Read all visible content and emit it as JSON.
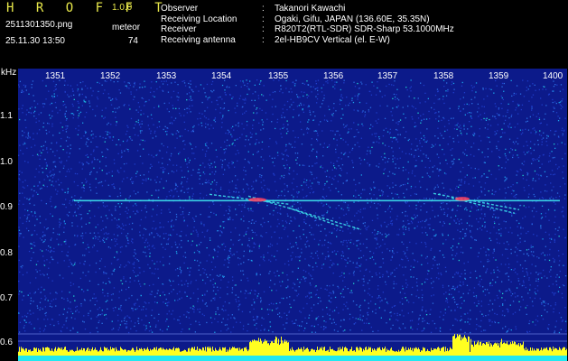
{
  "app": {
    "logo": "H R O F F T",
    "version": "1.0.0",
    "filename": "2511301350.png",
    "datetime": "25.11.30 13:50",
    "meteor_label": "meteor",
    "meteor_count": "74"
  },
  "info": [
    {
      "key": "Observer",
      "sep": ":",
      "value": "Takanori Kawachi"
    },
    {
      "key": "Receiving Location",
      "sep": ":",
      "value": "Ogaki, Gifu, JAPAN (136.60E, 35.35N)"
    },
    {
      "key": "Receiver",
      "sep": ":",
      "value": "R820T2(RTL-SDR) SDR-Sharp 53.1000MHz"
    },
    {
      "key": "Receiving antenna",
      "sep": ":",
      "value": "2el-HB9CV Vertical (el. E-W)"
    }
  ],
  "spectrogram": {
    "y_unit": "kHz",
    "y_ticks": [
      "1.1",
      "1.0",
      "0.9",
      "0.8",
      "0.7",
      "0.6"
    ],
    "x_ticks": [
      "1351",
      "1352",
      "1353",
      "1354",
      "1355",
      "1356",
      "1357",
      "1358",
      "1359",
      "1400"
    ],
    "carrier_khz": 0.92,
    "colors": {
      "background": "#0c1a8a",
      "noise": [
        "#1e3cc8",
        "#2a6de0",
        "#1aa0e8",
        "#20d0d0"
      ],
      "signal": "#40e8f0",
      "meteor_core": "#ff4060",
      "baseline": "#ffff20",
      "axis_text": "#ffffff",
      "header_accent": "#e8e84a"
    }
  }
}
